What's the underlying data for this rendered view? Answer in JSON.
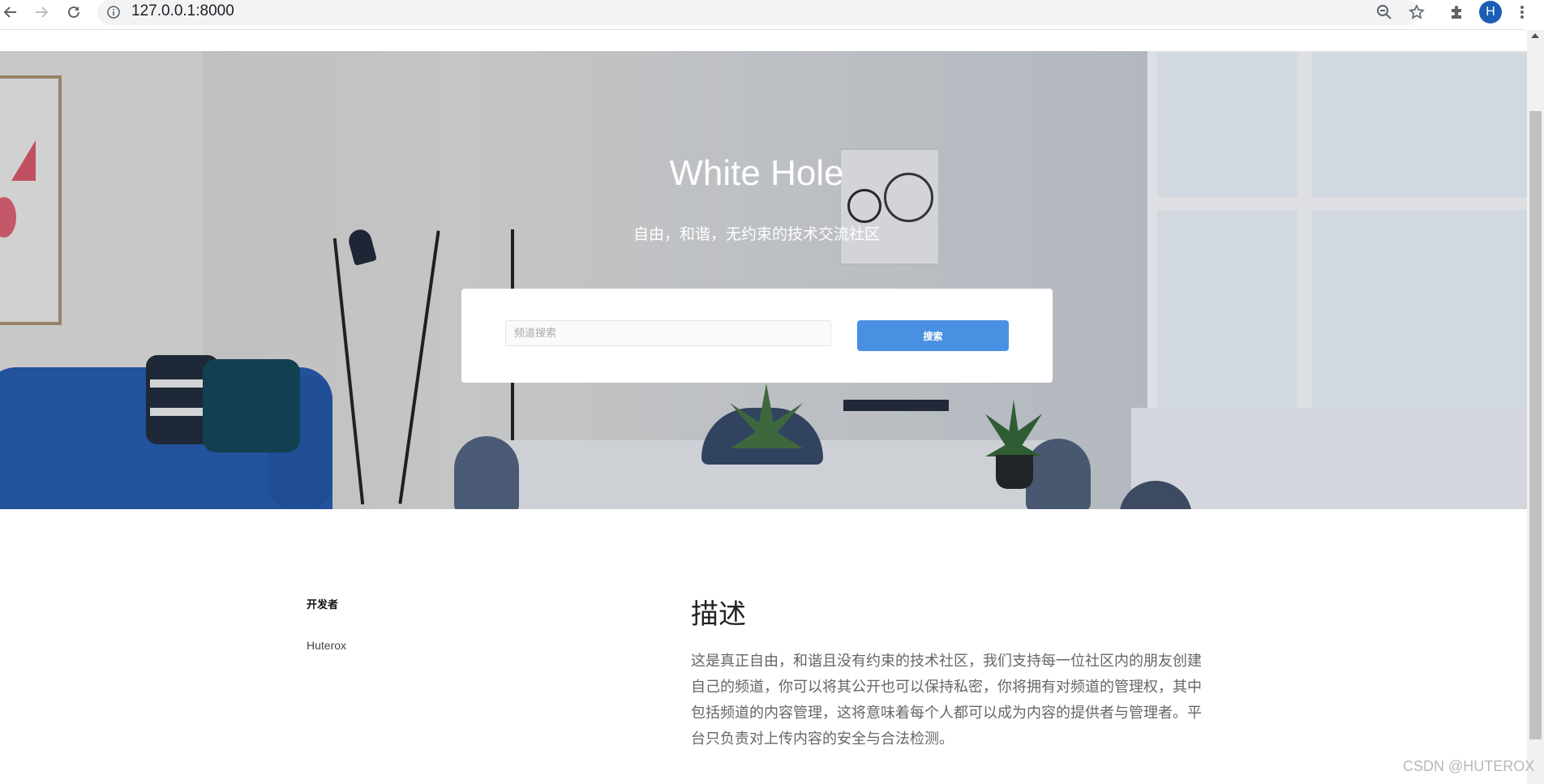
{
  "browser": {
    "url": "127.0.0.1:8000",
    "profile_initial": "H",
    "icons": [
      "back-icon",
      "forward-icon",
      "reload-icon",
      "info-icon",
      "zoom-out-icon",
      "star-icon",
      "extensions-icon",
      "menu-icon"
    ]
  },
  "hero": {
    "title": "White Hole",
    "subtitle": "自由，和谐，无约束的技术交流社区",
    "search": {
      "placeholder": "频道搜索",
      "button_label": "搜索"
    },
    "colors": {
      "button": "#4a90e2"
    }
  },
  "developers": {
    "heading": "开发者",
    "names": [
      "Huterox"
    ]
  },
  "description": {
    "heading": "描述",
    "body": "这是真正自由，和谐且没有约束的技术社区，我们支持每一位社区内的朋友创建自己的频道，你可以将其公开也可以保持私密，你将拥有对频道的管理权，其中包括频道的内容管理，这将意味着每个人都可以成为内容的提供者与管理者。平台只负责对上传内容的安全与合法检测。"
  },
  "watermark": "CSDN @HUTEROX"
}
